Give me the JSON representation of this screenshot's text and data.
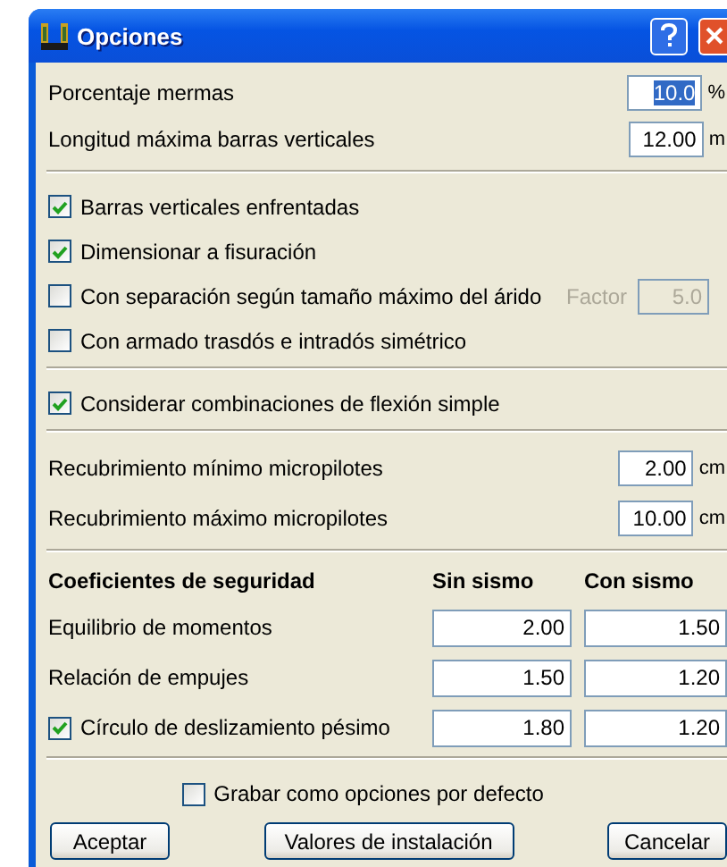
{
  "window": {
    "title": "Opciones"
  },
  "fields": [
    {
      "label": "Porcentaje mermas",
      "value": "10.0",
      "unit": "%",
      "selected": true
    },
    {
      "label": "Longitud máxima barras verticales",
      "value": "12.00",
      "unit": "m",
      "selected": false
    }
  ],
  "options": [
    {
      "label": "Barras verticales enfrentadas",
      "checked": true
    },
    {
      "label": "Dimensionar a fisuración",
      "checked": true
    },
    {
      "label": "Con separación según tamaño máximo del árido",
      "checked": false,
      "factor": {
        "label": "Factor",
        "value": "5.0",
        "disabled": true
      }
    },
    {
      "label": "Con armado trasdós e intradós simétrico",
      "checked": false
    }
  ],
  "flexion": {
    "label": "Considerar combinaciones de flexión simple",
    "checked": true
  },
  "cover_fields": [
    {
      "label": "Recubrimiento mínimo micropilotes",
      "value": "2.00",
      "unit": "cm",
      "selected": false
    },
    {
      "label": "Recubrimiento máximo micropilotes",
      "value": "10.00",
      "unit": "cm",
      "selected": false
    }
  ],
  "safety": {
    "columns": [
      "Coeficientes de seguridad",
      "Sin sismo",
      "Con sismo"
    ],
    "rows": [
      {
        "kind": "label",
        "label": "Equilibrio de momentos",
        "values": [
          "2.00",
          "1.50"
        ]
      },
      {
        "kind": "label",
        "label": "Relación de empujes",
        "values": [
          "1.50",
          "1.20"
        ]
      },
      {
        "kind": "checkbox",
        "label": "Círculo de deslizamiento pésimo",
        "checked": true,
        "values": [
          "1.80",
          "1.20"
        ]
      }
    ]
  },
  "save_default": {
    "label": "Grabar como opciones por defecto",
    "checked": false
  },
  "buttons": [
    "Aceptar",
    "Valores de instalación",
    "Cancelar"
  ]
}
